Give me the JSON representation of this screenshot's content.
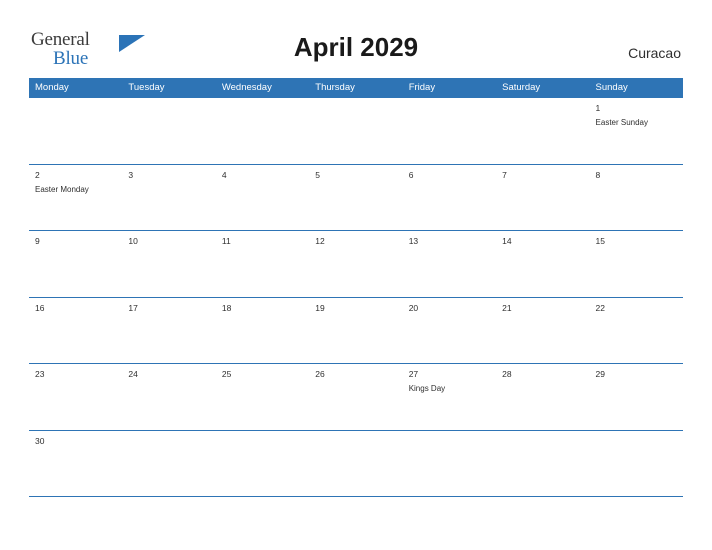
{
  "header": {
    "logo_general": "General",
    "logo_blue": "Blue",
    "logo_triangle_icon": "triangle-logo-icon",
    "title": "April 2029",
    "locale": "Curacao"
  },
  "calendar": {
    "weekdays": [
      "Monday",
      "Tuesday",
      "Wednesday",
      "Thursday",
      "Friday",
      "Saturday",
      "Sunday"
    ],
    "accent_color": "#2e74b5",
    "shade_color": "#f2f2f2",
    "weeks": [
      [
        {
          "num": "",
          "event": ""
        },
        {
          "num": "",
          "event": ""
        },
        {
          "num": "",
          "event": ""
        },
        {
          "num": "",
          "event": ""
        },
        {
          "num": "",
          "event": ""
        },
        {
          "num": "",
          "event": ""
        },
        {
          "num": "1",
          "event": "Easter Sunday"
        }
      ],
      [
        {
          "num": "2",
          "event": "Easter Monday"
        },
        {
          "num": "3",
          "event": ""
        },
        {
          "num": "4",
          "event": ""
        },
        {
          "num": "5",
          "event": ""
        },
        {
          "num": "6",
          "event": ""
        },
        {
          "num": "7",
          "event": ""
        },
        {
          "num": "8",
          "event": ""
        }
      ],
      [
        {
          "num": "9",
          "event": ""
        },
        {
          "num": "10",
          "event": ""
        },
        {
          "num": "11",
          "event": ""
        },
        {
          "num": "12",
          "event": ""
        },
        {
          "num": "13",
          "event": ""
        },
        {
          "num": "14",
          "event": ""
        },
        {
          "num": "15",
          "event": ""
        }
      ],
      [
        {
          "num": "16",
          "event": ""
        },
        {
          "num": "17",
          "event": ""
        },
        {
          "num": "18",
          "event": ""
        },
        {
          "num": "19",
          "event": ""
        },
        {
          "num": "20",
          "event": ""
        },
        {
          "num": "21",
          "event": ""
        },
        {
          "num": "22",
          "event": ""
        }
      ],
      [
        {
          "num": "23",
          "event": ""
        },
        {
          "num": "24",
          "event": ""
        },
        {
          "num": "25",
          "event": ""
        },
        {
          "num": "26",
          "event": ""
        },
        {
          "num": "27",
          "event": "Kings Day"
        },
        {
          "num": "28",
          "event": ""
        },
        {
          "num": "29",
          "event": ""
        }
      ],
      [
        {
          "num": "30",
          "event": ""
        },
        {
          "num": "",
          "event": ""
        },
        {
          "num": "",
          "event": ""
        },
        {
          "num": "",
          "event": ""
        },
        {
          "num": "",
          "event": ""
        },
        {
          "num": "",
          "event": ""
        },
        {
          "num": "",
          "event": ""
        }
      ]
    ]
  }
}
